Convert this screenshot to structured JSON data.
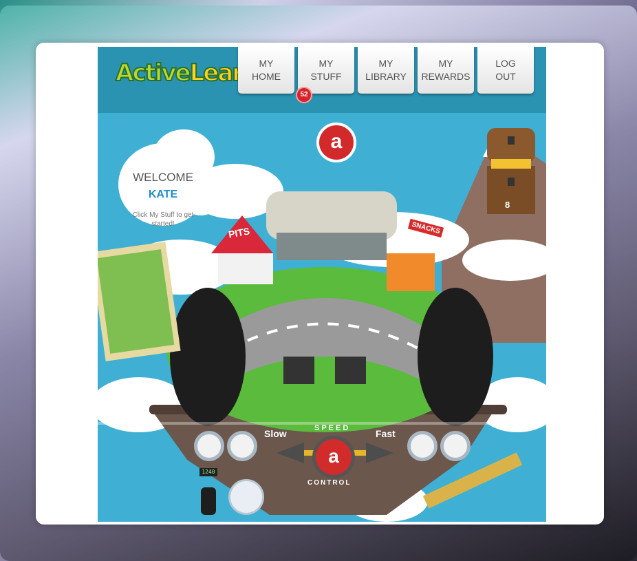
{
  "app": {
    "logo_text_part1": "Active",
    "logo_text_part2": "Learn"
  },
  "nav": [
    {
      "label": "MY\nHOME"
    },
    {
      "label": "MY\nSTUFF"
    },
    {
      "label": "MY\nLIBRARY"
    },
    {
      "label": "MY\nREWARDS"
    },
    {
      "label": "LOG\nOUT"
    }
  ],
  "stuff_badge": "52",
  "welcome": {
    "title": "WELCOME",
    "name": "KATE",
    "hint": "Click My Stuff to get started!"
  },
  "treasure": {
    "count": "8"
  },
  "scene_signs": {
    "pits": "PITS",
    "snacks": "SNACKS"
  },
  "speed_control": {
    "slow": "Slow",
    "fast": "Fast",
    "speed": "SPEED",
    "control": "CONTROL",
    "logo": "a"
  },
  "meter": {
    "readout": "1240"
  },
  "colors": {
    "accent": "#d5252c",
    "name": "#1e8ec2",
    "header": "#2a93b1"
  }
}
